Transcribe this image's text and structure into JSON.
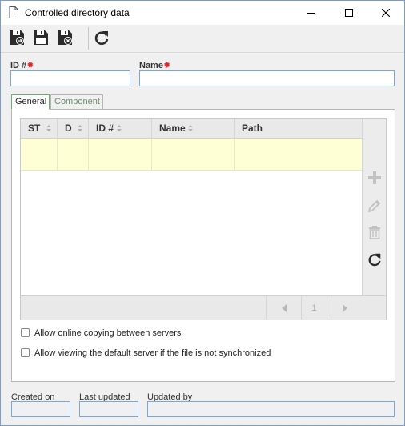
{
  "window": {
    "title": "Controlled directory data",
    "minimize_icon": "minimize-icon",
    "maximize_icon": "maximize-icon",
    "close_icon": "close-icon"
  },
  "toolbar": {
    "items": [
      "save-and-new-icon",
      "save-icon",
      "save-and-close-icon",
      "refresh-icon"
    ]
  },
  "fields": {
    "id_label": "ID #",
    "id_value": "",
    "name_label": "Name",
    "name_value": ""
  },
  "tabs": [
    {
      "label": "General",
      "active": true
    },
    {
      "label": "Component",
      "active": false
    }
  ],
  "grid": {
    "columns": [
      "ST",
      "D",
      "ID #",
      "Name",
      "Path"
    ],
    "rows": [
      [
        "",
        "",
        "",
        "",
        ""
      ]
    ],
    "side_buttons": [
      "plus-icon",
      "pencil-icon",
      "trash-icon",
      "refresh-icon"
    ],
    "pagination": {
      "page": "1"
    }
  },
  "options": [
    {
      "label": "Allow online copying between servers",
      "checked": false
    },
    {
      "label": "Allow viewing the default server if the file is not synchronized",
      "checked": false
    }
  ],
  "footer": {
    "created_on_label": "Created on",
    "created_on_value": "",
    "last_updated_label": "Last updated",
    "last_updated_value": "",
    "updated_by_label": "Updated by",
    "updated_by_value": ""
  },
  "colors": {
    "required_marker": "#d9262c",
    "selected_row": "#ffffd6",
    "input_border": "#7aa7d6"
  }
}
